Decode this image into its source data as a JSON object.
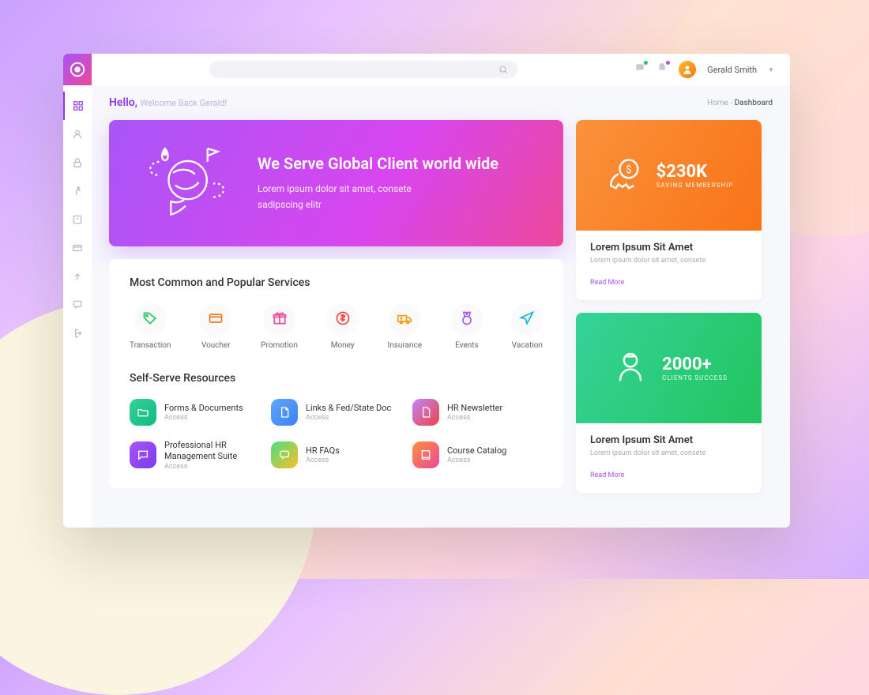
{
  "header": {
    "user_name": "Gerald Smith",
    "search_placeholder": ""
  },
  "greeting": {
    "hello": "Hello,",
    "sub": "Welcome Back Gerald!"
  },
  "breadcrumb": {
    "home": "Home",
    "sep": " - ",
    "current": "Dashboard"
  },
  "hero": {
    "title": "We Serve Global Client world wide",
    "line1": "Lorem ipsum dolor sit amet, consete",
    "line2": "sadipscing elitr"
  },
  "services": {
    "title": "Most Common and Popular Services",
    "items": [
      {
        "label": "Transaction"
      },
      {
        "label": "Voucher"
      },
      {
        "label": "Promotion"
      },
      {
        "label": "Money"
      },
      {
        "label": "Insurance"
      },
      {
        "label": "Events"
      },
      {
        "label": "Vacation"
      }
    ]
  },
  "resources": {
    "title": "Self-Serve Resources",
    "access": "Access",
    "items": [
      {
        "title": "Forms & Documents"
      },
      {
        "title": "Links & Fed/State Doc"
      },
      {
        "title": "HR Newsletter"
      },
      {
        "title": "Professional HR Management Suite"
      },
      {
        "title": "HR FAQs"
      },
      {
        "title": "Course Catalog"
      }
    ]
  },
  "cards": [
    {
      "value": "$230K",
      "label": "SAVING MEMBERSHIP",
      "title": "Lorem Ipsum Sit Amet",
      "desc": "Lorem ipsum dolor sit amet, consete",
      "link": "Read More"
    },
    {
      "value": "2000+",
      "label": "CLIENTS SUCCESS",
      "title": "Lorem Ipsum Sit Amet",
      "desc": "Lorem ipsum dolor sit amet, consete",
      "link": "Read More"
    }
  ]
}
